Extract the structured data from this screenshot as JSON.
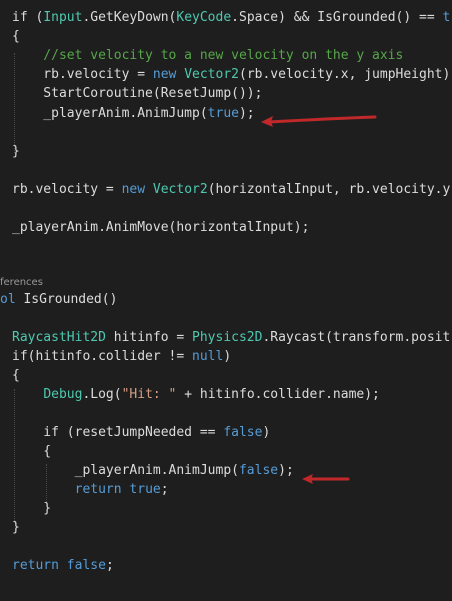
{
  "code": {
    "lines": [
      [
        {
          "t": "if (",
          "c": "pl"
        },
        {
          "t": "Input",
          "c": "ty"
        },
        {
          "t": ".GetKeyDown(",
          "c": "pl"
        },
        {
          "t": "KeyCode",
          "c": "ty"
        },
        {
          "t": ".Space) && IsGrounded() == ",
          "c": "pl"
        },
        {
          "t": "tr",
          "c": "kw"
        }
      ],
      [
        {
          "t": "{",
          "c": "pl"
        }
      ],
      [
        {
          "t": "    //set velocity to a new velocity on the y axis",
          "c": "cm"
        }
      ],
      [
        {
          "t": "    rb.velocity = ",
          "c": "pl"
        },
        {
          "t": "new ",
          "c": "kw"
        },
        {
          "t": "Vector2",
          "c": "ty"
        },
        {
          "t": "(rb.velocity.x, jumpHeight);",
          "c": "pl"
        }
      ],
      [
        {
          "t": "    StartCoroutine(ResetJump());",
          "c": "pl"
        }
      ],
      [
        {
          "t": "    _playerAnim.AnimJump(",
          "c": "pl"
        },
        {
          "t": "true",
          "c": "kw"
        },
        {
          "t": ");",
          "c": "pl"
        }
      ],
      [],
      [
        {
          "t": "}",
          "c": "pl"
        }
      ],
      [],
      [
        {
          "t": "rb.velocity = ",
          "c": "pl"
        },
        {
          "t": "new ",
          "c": "kw"
        },
        {
          "t": "Vector2",
          "c": "ty"
        },
        {
          "t": "(horizontalInput, rb.velocity.y",
          "c": "pl"
        }
      ],
      [],
      [
        {
          "t": "_playerAnim.AnimMove(horizontalInput);",
          "c": "pl"
        }
      ],
      [],
      [
        {
          "t": "ferences",
          "c": "codelens"
        }
      ],
      [
        {
          "t": "ol ",
          "c": "kw"
        },
        {
          "t": "IsGrounded()",
          "c": "pl"
        }
      ],
      [],
      [
        {
          "t": "RaycastHit2D",
          "c": "ty"
        },
        {
          "t": " hitinfo = ",
          "c": "pl"
        },
        {
          "t": "Physics2D",
          "c": "ty"
        },
        {
          "t": ".Raycast(transform.posit",
          "c": "pl"
        }
      ],
      [
        {
          "t": "if(hitinfo.collider != ",
          "c": "pl"
        },
        {
          "t": "null",
          "c": "kw"
        },
        {
          "t": ")",
          "c": "pl"
        }
      ],
      [
        {
          "t": "{",
          "c": "pl"
        }
      ],
      [
        {
          "t": "    ",
          "c": "pl"
        },
        {
          "t": "Debug",
          "c": "ty"
        },
        {
          "t": ".Log(",
          "c": "pl"
        },
        {
          "t": "\"Hit: \"",
          "c": "st"
        },
        {
          "t": " + hitinfo.collider.name);",
          "c": "pl"
        }
      ],
      [],
      [
        {
          "t": "    if (resetJumpNeeded == ",
          "c": "pl"
        },
        {
          "t": "false",
          "c": "kw"
        },
        {
          "t": ")",
          "c": "pl"
        }
      ],
      [
        {
          "t": "    {",
          "c": "pl"
        }
      ],
      [
        {
          "t": "        _playerAnim.AnimJump(",
          "c": "pl"
        },
        {
          "t": "false",
          "c": "kw"
        },
        {
          "t": ");",
          "c": "pl"
        }
      ],
      [
        {
          "t": "        ",
          "c": "pl"
        },
        {
          "t": "return ",
          "c": "kw"
        },
        {
          "t": "true",
          "c": "kw"
        },
        {
          "t": ";",
          "c": "pl"
        }
      ],
      [
        {
          "t": "    }",
          "c": "pl"
        }
      ],
      [
        {
          "t": "}",
          "c": "pl"
        }
      ],
      [],
      [
        {
          "t": "return ",
          "c": "kw"
        },
        {
          "t": "false",
          "c": "kw"
        },
        {
          "t": ";",
          "c": "pl"
        }
      ]
    ]
  },
  "colors": {
    "background": "#1e1e1e",
    "keyword": "#569cd6",
    "type": "#4ec9b0",
    "comment": "#57a64a",
    "string": "#d69d85",
    "plain": "#dcdcdc",
    "annotation_arrow": "#c0282a"
  },
  "annotations": [
    {
      "icon": "red-arrow-icon",
      "points_to": "_playerAnim.AnimJump(true);"
    },
    {
      "icon": "red-arrow-icon",
      "points_to": "_playerAnim.AnimJump(false);"
    }
  ]
}
